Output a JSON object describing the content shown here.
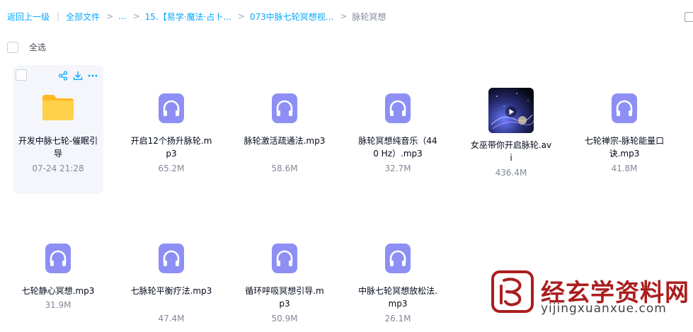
{
  "breadcrumb": {
    "back": "返回上一级",
    "separator": "|",
    "all_files": "全部文件",
    "ellipsis": "...",
    "folder1": "15.【易学·魔法·占卜...",
    "folder2": "073中脉七轮冥想视...",
    "current": "脉轮冥想"
  },
  "select_all": {
    "label": "全选"
  },
  "colors": {
    "link": "#06a7ff",
    "folder": "#ffc933",
    "audio_icon": "#8d8ff5",
    "meta_text": "#818999",
    "watermark": "#aa1e1e"
  },
  "files": [
    {
      "type": "folder",
      "name": "开发中脉七轮-催眠引导",
      "meta": "07-24 21:28",
      "icon": "folder-icon",
      "hovered": true
    },
    {
      "type": "audio",
      "name": "开启12个扬升脉轮.mp3",
      "meta": "65.2M",
      "icon": "headphones-icon"
    },
    {
      "type": "audio",
      "name": "脉轮激活疏通法.mp3",
      "meta": "58.6M",
      "icon": "headphones-icon"
    },
    {
      "type": "audio",
      "name": "脉轮冥想纯音乐（440 Hz）.mp3",
      "meta": "32.7M",
      "icon": "headphones-icon"
    },
    {
      "type": "video",
      "name": "女巫带你开启脉轮.avi",
      "meta": "436.4M",
      "icon": "play-icon"
    },
    {
      "type": "audio",
      "name": "七轮禅宗-脉轮能量口诀.mp3",
      "meta": "41.8M",
      "icon": "headphones-icon"
    },
    {
      "type": "audio",
      "name": "七轮静心冥想.mp3",
      "meta": "31.9M",
      "icon": "headphones-icon"
    },
    {
      "type": "audio",
      "name": "七脉轮平衡疗法.mp3",
      "meta": "47.4M",
      "icon": "headphones-icon"
    },
    {
      "type": "audio",
      "name": "循环呼吸冥想引导.mp3",
      "meta": "50.9M",
      "icon": "headphones-icon"
    },
    {
      "type": "audio",
      "name": "中脉七轮冥想放松法.mp3",
      "meta": "26.1M",
      "icon": "headphones-icon"
    }
  ],
  "watermark": {
    "title": "经玄学资料网",
    "url": "yijingxuanxue.com"
  }
}
